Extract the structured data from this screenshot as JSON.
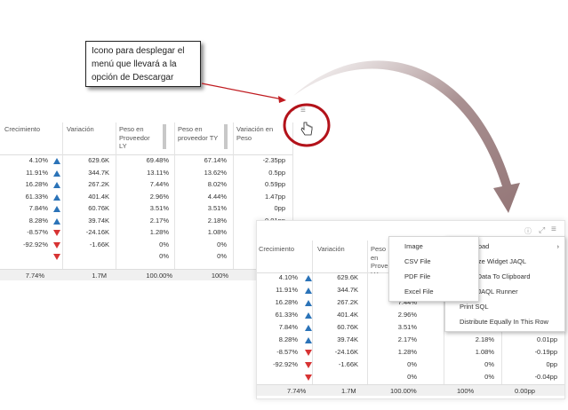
{
  "callout": {
    "line1": "Icono para desplegar el",
    "line2": "menú que llevará a la",
    "line3": "opción de Descargar"
  },
  "table": {
    "headers": [
      "Crecimiento",
      "Variación",
      "Peso en Proveedor LY",
      "Peso en proveedor TY",
      "Variación en Peso"
    ],
    "rows": [
      {
        "crec": "4.10%",
        "dir": "up",
        "var": "629.6K",
        "ly": "69.48%",
        "ty": "67.14%",
        "vp": "-2.35pp"
      },
      {
        "crec": "11.91%",
        "dir": "up",
        "var": "344.7K",
        "ly": "13.11%",
        "ty": "13.62%",
        "vp": "0.5pp"
      },
      {
        "crec": "16.28%",
        "dir": "up",
        "var": "267.2K",
        "ly": "7.44%",
        "ty": "8.02%",
        "vp": "0.59pp"
      },
      {
        "crec": "61.33%",
        "dir": "up",
        "var": "401.4K",
        "ly": "2.96%",
        "ty": "4.44%",
        "vp": "1.47pp"
      },
      {
        "crec": "7.84%",
        "dir": "up",
        "var": "60.76K",
        "ly": "3.51%",
        "ty": "3.51%",
        "vp": "0pp"
      },
      {
        "crec": "8.28%",
        "dir": "up",
        "var": "39.74K",
        "ly": "2.17%",
        "ty": "2.18%",
        "vp": "0.01pp"
      },
      {
        "crec": "-8.57%",
        "dir": "down",
        "var": "-24.16K",
        "ly": "1.28%",
        "ty": "1.08%",
        "vp": "-0.19pp"
      },
      {
        "crec": "-92.92%",
        "dir": "down",
        "var": "-1.66K",
        "ly": "0%",
        "ty": "0%",
        "vp": "0pp"
      },
      {
        "crec": "",
        "dir": "down",
        "var": "",
        "ly": "0%",
        "ty": "0%",
        "vp": "-0.04pp"
      }
    ],
    "totals": {
      "crec": "7.74%",
      "var": "1.7M",
      "ly": "100.00%",
      "ty": "100%",
      "vp": "0.00pp"
    }
  },
  "menu_download": {
    "items": [
      "Image",
      "CSV File",
      "PDF File",
      "Excel File"
    ]
  },
  "menu_main": {
    "download_label": "Download",
    "items": [
      "Serialize Widget JAQL",
      "Copy Data To Clipboard",
      "Open JAQL Runner",
      "Print SQL",
      "Distribute Equally In This Row"
    ],
    "chevron": "›"
  },
  "icons": {
    "expand": "expand-icon",
    "menu": "hamburger-menu-icon",
    "info": "info-icon"
  },
  "colors": {
    "highlight_ring": "#b3121a",
    "arrow_fill": "#9c7f80",
    "up": "#2b73b8",
    "down": "#d73333"
  }
}
